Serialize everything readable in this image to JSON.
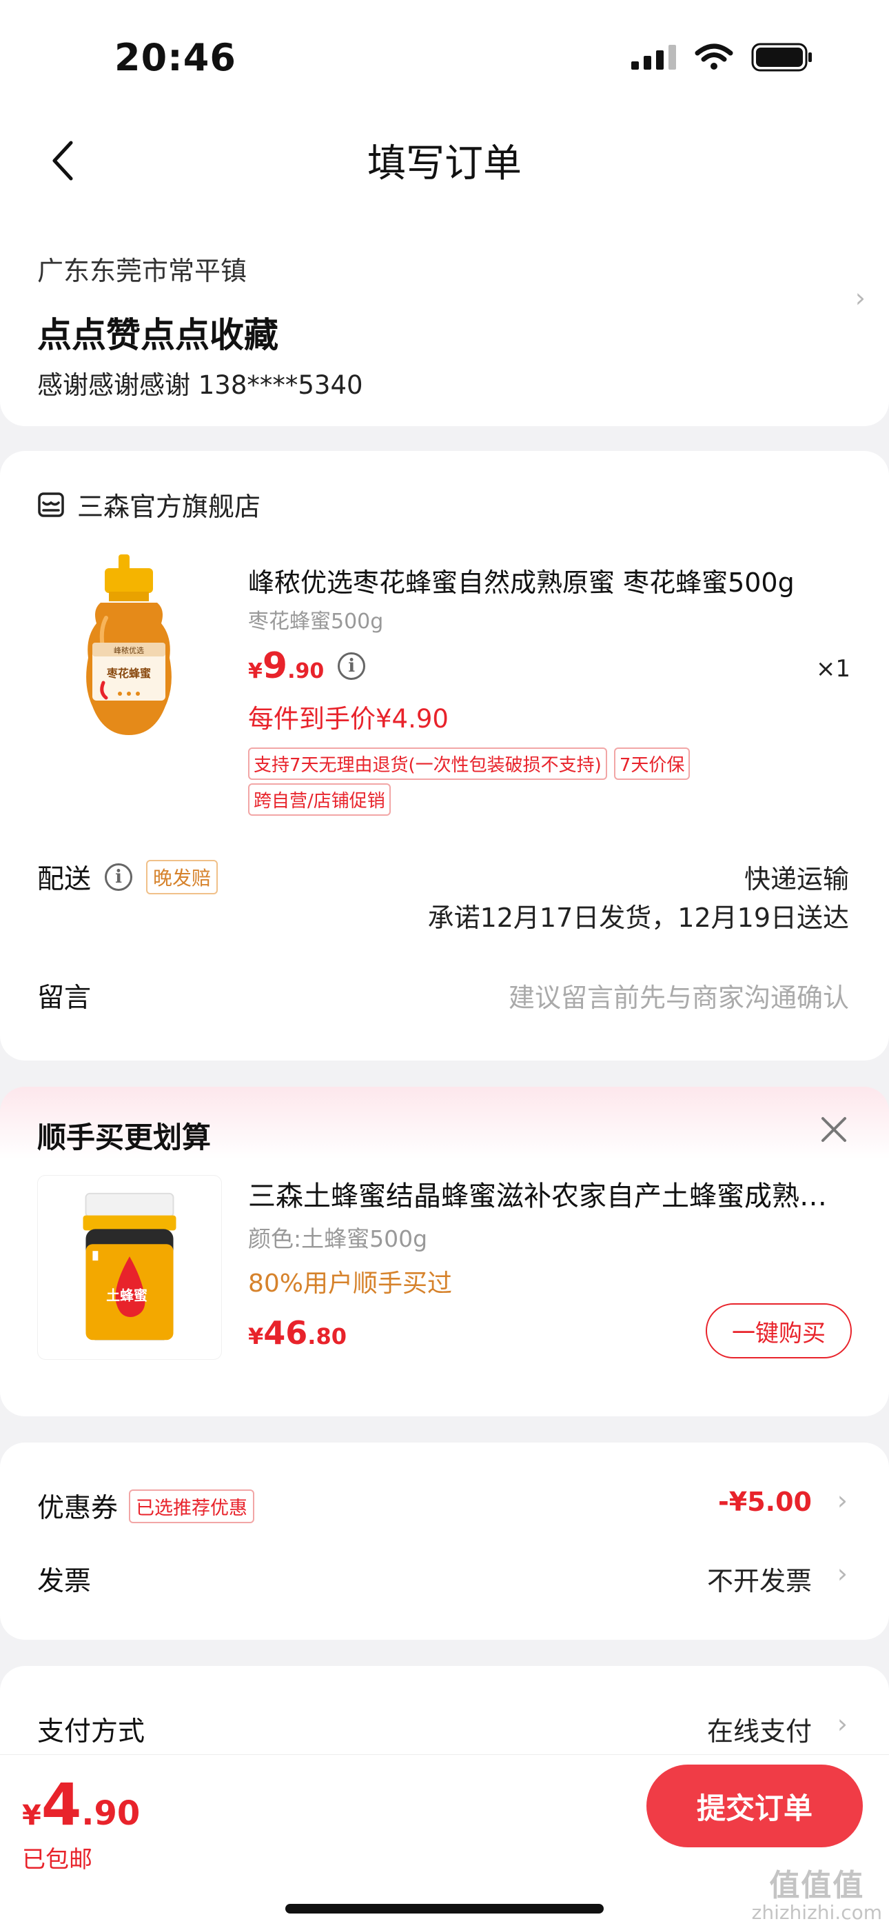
{
  "status_bar": {
    "time": "20:46"
  },
  "nav": {
    "title": "填写订单"
  },
  "address": {
    "region": "广东东莞市常平镇",
    "name": "点点赞点点收藏",
    "contact": "感谢感谢感谢  138****5340"
  },
  "store": {
    "name": "三森官方旗舰店"
  },
  "product": {
    "title": "峰秾优选枣花蜂蜜自然成熟原蜜 枣花蜂蜜500g",
    "spec": "枣花蜂蜜500g",
    "price_currency": "¥",
    "price_int": "9",
    "price_dec": ".90",
    "quantity": "×1",
    "per_item_price": "每件到手价¥4.90",
    "tags_row1": [
      "支持7天无理由退货(一次性包装破损不支持)",
      "7天价保"
    ],
    "tags_row2": [
      "跨自营/店铺促销"
    ],
    "image_label": "枣花蜂蜜",
    "image_top_label": "峰秾优选"
  },
  "delivery": {
    "label": "配送",
    "badge": "晚发赔",
    "method": "快递运输",
    "promise": "承诺12月17日发货，12月19日送达"
  },
  "message": {
    "label": "留言",
    "placeholder": "建议留言前先与商家沟通确认"
  },
  "recommendation": {
    "title": "顺手买更划算",
    "product_name": "三森土蜂蜜结晶蜂蜜滋补农家自产土蜂蜜成熟蜂蜜",
    "spec": "颜色:土蜂蜜500g",
    "social": "80%用户顺手买过",
    "price_currency": "¥",
    "price_int": "46",
    "price_dec": ".80",
    "buy_label": "一键购买",
    "image_label": "土蜂蜜"
  },
  "coupon": {
    "label": "优惠券",
    "badge": "已选推荐优惠",
    "value": "-¥5.00"
  },
  "invoice": {
    "label": "发票",
    "value": "不开发票"
  },
  "payment": {
    "label": "支付方式",
    "value": "在线支付"
  },
  "bottom": {
    "total_currency": "¥",
    "total_int": "4",
    "total_dec": ".90",
    "shipping": "已包邮",
    "submit_label": "提交订单"
  },
  "watermark": {
    "glyphs": "值值值",
    "url": "zhizhizhi.com"
  },
  "colors": {
    "accent": "#e8232b",
    "submit": "#f03c46",
    "orange": "#d6822b"
  }
}
